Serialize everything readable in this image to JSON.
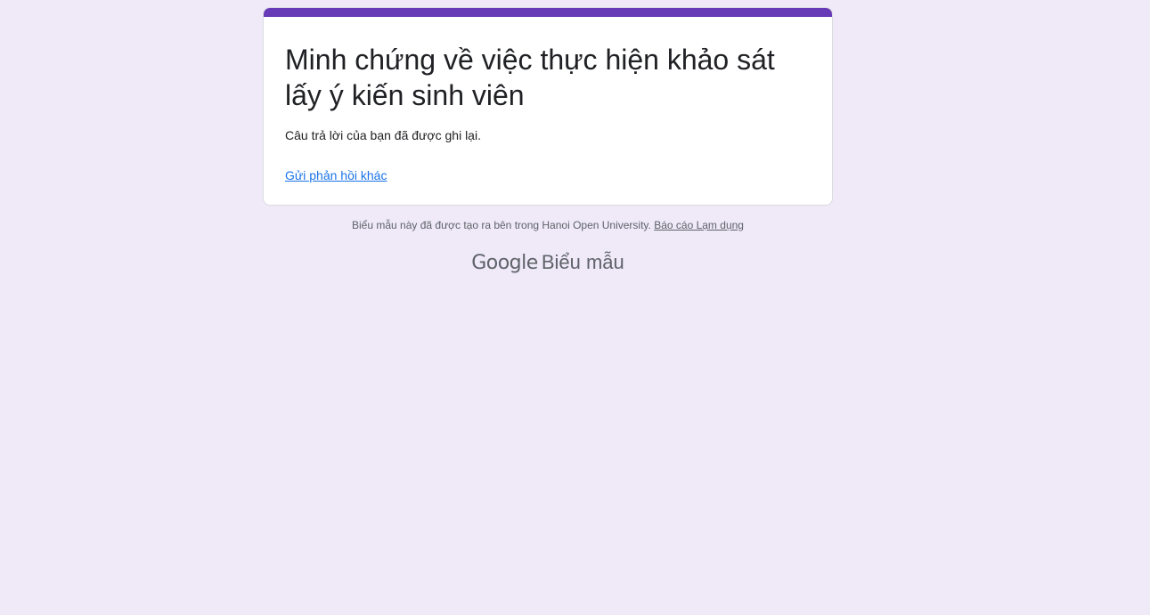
{
  "form": {
    "title": "Minh chứng về việc thực hiện khảo sát lấy ý kiến sinh viên",
    "confirmation_message": "Câu trả lời của bạn đã được ghi lại.",
    "another_response_link": "Gửi phản hồi khác"
  },
  "footer": {
    "note": "Biểu mẫu này đã được tạo ra bên trong Hanoi Open University.",
    "report_abuse_link": "Báo cáo Lạm dụng"
  },
  "brand": {
    "google": "Google",
    "product": "Biểu mẫu"
  },
  "colors": {
    "background": "#efe9f8",
    "accent": "#673ab7",
    "link": "#1a73e8"
  }
}
